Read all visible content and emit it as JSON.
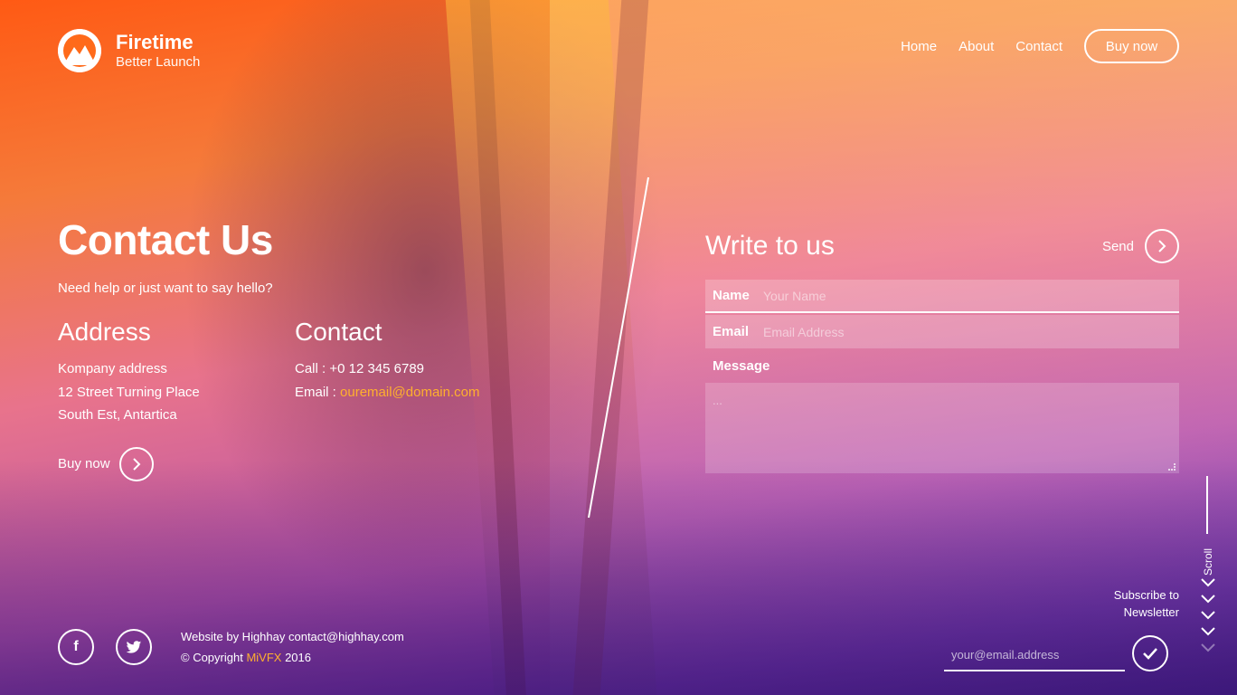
{
  "brand": {
    "name": "Firetime",
    "tagline": "Better Launch",
    "logo_icon": "mountain-logo-icon"
  },
  "nav": {
    "items": [
      "Home",
      "About",
      "Contact"
    ],
    "buy_label": "Buy now"
  },
  "hero": {
    "title": "Contact Us",
    "subtitle": "Need help or just want to say hello?"
  },
  "address": {
    "heading": "Address",
    "lines": [
      "Kompany address",
      "12 Street Turning Place",
      "South Est, Antartica"
    ]
  },
  "contact": {
    "heading": "Contact",
    "call_label": "Call : ",
    "call_value": "+0 12 345 6789",
    "email_label": "Email : ",
    "email_value": "ouremail@domain.com"
  },
  "buy_now": {
    "label": "Buy now",
    "icon": "chevron-right-icon"
  },
  "form": {
    "title": "Write to us",
    "send_label": "Send",
    "name_label": "Name",
    "name_placeholder": "Your Name",
    "email_label": "Email",
    "email_placeholder": "Email Address",
    "message_label": "Message",
    "message_placeholder": "..."
  },
  "footer": {
    "social": [
      "facebook-icon",
      "twitter-icon"
    ],
    "credit_line": "Website by Highhay contact@highhay.com",
    "copyright_prefix": "© Copyright ",
    "copyright_brand": "MiVFX",
    "copyright_year": " 2016"
  },
  "newsletter": {
    "label_line1": "Subscribe to",
    "label_line2": "Newsletter",
    "placeholder": "your@email.address"
  },
  "scroll": {
    "label": "Scroll"
  },
  "colors": {
    "accent": "#ffb02e",
    "text": "#ffffff"
  }
}
